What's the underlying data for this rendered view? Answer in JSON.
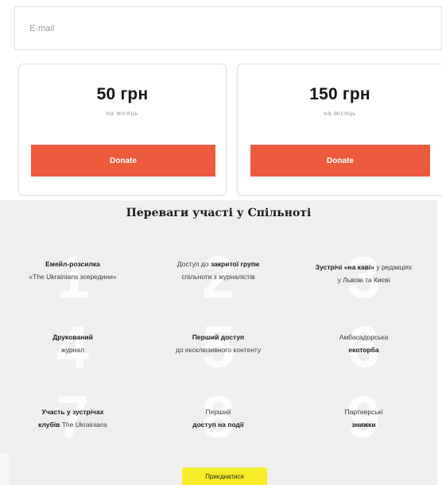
{
  "email": {
    "placeholder": "E-mail"
  },
  "plans": [
    {
      "price": "50 грн",
      "period": "на місяць",
      "button": "Donate"
    },
    {
      "price": "150 грн",
      "period": "на місяць",
      "button": "Donate"
    }
  ],
  "benefits": {
    "title": "Переваги участі у Спільноті",
    "items": [
      {
        "num": "1",
        "l1_pre": "",
        "l1_bold": "Емейл-розсилка",
        "l1_post": "",
        "l2_pre": "«The Ukrainians зсередини»",
        "l2_bold": "",
        "l2_post": ""
      },
      {
        "num": "2",
        "l1_pre": "Доступ до ",
        "l1_bold": "закритої групи",
        "l1_post": "",
        "l2_pre": "спільноти з журналістів",
        "l2_bold": "",
        "l2_post": ""
      },
      {
        "num": "3",
        "l1_pre": "",
        "l1_bold": "Зустрічі «на каві»",
        "l1_post": " у редакціях",
        "l2_pre": "у Львові та Києві",
        "l2_bold": "",
        "l2_post": ""
      },
      {
        "num": "4",
        "l1_pre": "",
        "l1_bold": "Друкований",
        "l1_post": "",
        "l2_pre": "журнал",
        "l2_bold": "",
        "l2_post": ""
      },
      {
        "num": "5",
        "l1_pre": "",
        "l1_bold": "Перший доступ",
        "l1_post": "",
        "l2_pre": "до ексклюзивного контенту",
        "l2_bold": "",
        "l2_post": ""
      },
      {
        "num": "6",
        "l1_pre": "Амбасадорська",
        "l1_bold": "",
        "l1_post": "",
        "l2_pre": "",
        "l2_bold": "екоторба",
        "l2_post": ""
      },
      {
        "num": "7",
        "l1_pre": "",
        "l1_bold": "Участь у зустрічах",
        "l1_post": "",
        "l2_pre": "",
        "l2_bold": "клубів",
        "l2_post": " The Ukrainians"
      },
      {
        "num": "8",
        "l1_pre": "Перший",
        "l1_bold": "",
        "l1_post": "",
        "l2_pre": "",
        "l2_bold": "доступ на події",
        "l2_post": ""
      },
      {
        "num": "9",
        "l1_pre": "Партнерські",
        "l1_bold": "",
        "l1_post": "",
        "l2_pre": "",
        "l2_bold": "знижки",
        "l2_post": ""
      }
    ],
    "join_label": "Приєднатися"
  },
  "colors": {
    "accent": "#ee5a3c",
    "join": "#f6ec28",
    "section_bg": "#efefef"
  }
}
